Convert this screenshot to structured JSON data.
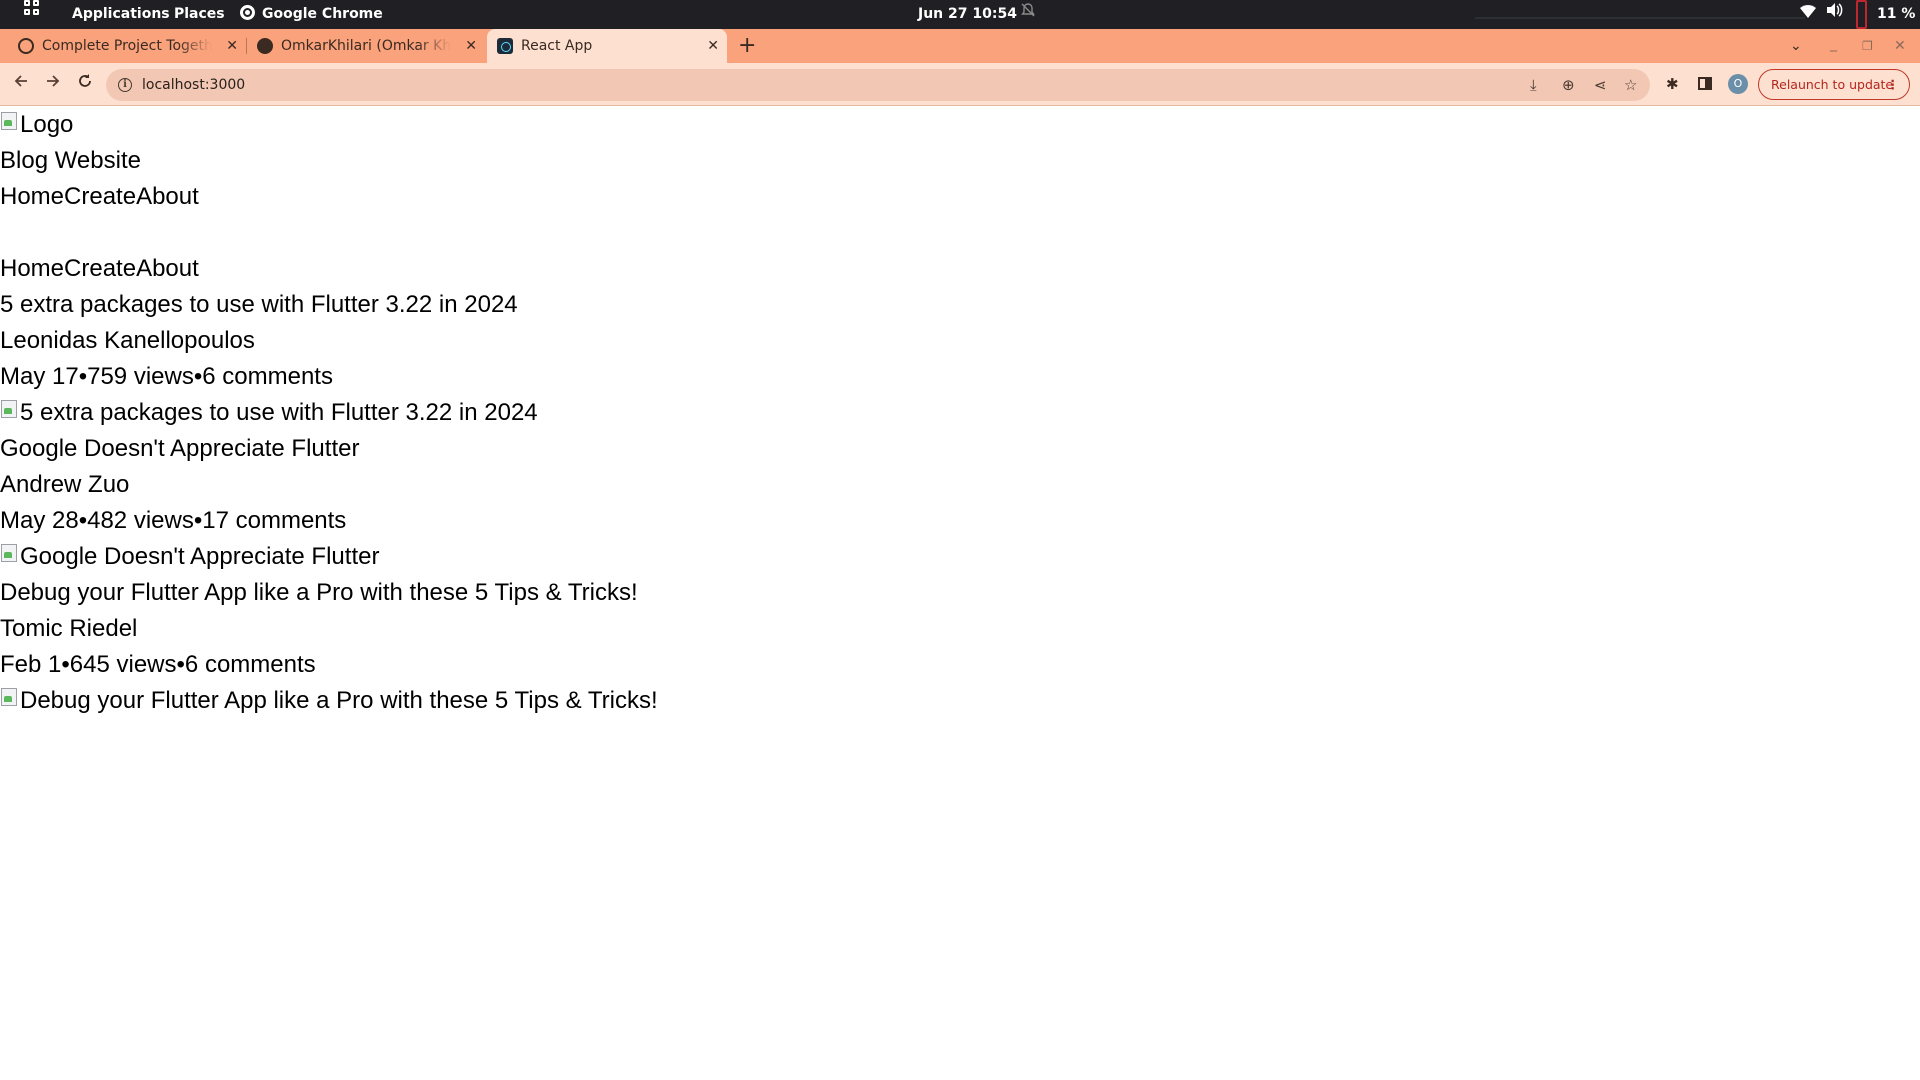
{
  "system_bar": {
    "applications_label": "Applications",
    "places_label": "Places",
    "active_app_label": "Google Chrome",
    "clock": "Jun 27  10:54",
    "battery": "11 %"
  },
  "browser": {
    "tabs": [
      {
        "title": "Complete Project Together"
      },
      {
        "title": "OmkarKhilari (Omkar Khilari)"
      },
      {
        "title": "React App"
      }
    ],
    "new_tab_symbol": "+",
    "address": "localhost:3000",
    "relaunch_label": "Relaunch to update",
    "profile_initial": "O"
  },
  "page": {
    "logo_alt": "Logo",
    "site_title": "Blog Website",
    "nav_top": [
      "Home",
      "Create",
      "About"
    ],
    "nav_bottom": [
      "Home",
      "Create",
      "About"
    ],
    "posts": [
      {
        "title": "5 extra packages to use with Flutter 3.22 in 2024",
        "author": "Leonidas Kanellopoulos",
        "date": "May 17",
        "views": "759 views",
        "comments": "6 comments",
        "image_alt": "5 extra packages to use with Flutter 3.22 in 2024"
      },
      {
        "title": "Google Doesn't Appreciate Flutter",
        "author": "Andrew Zuo",
        "date": "May 28",
        "views": "482 views",
        "comments": "17 comments",
        "image_alt": "Google Doesn't Appreciate Flutter"
      },
      {
        "title": "Debug your Flutter App like a Pro with these 5 Tips & Tricks!",
        "author": "Tomic Riedel",
        "date": "Feb 1",
        "views": "645 views",
        "comments": "6 comments",
        "image_alt": "Debug your Flutter App like a Pro with these 5 Tips & Tricks!"
      }
    ],
    "meta_separator": "•"
  },
  "icons": {
    "back": "back-arrow-icon",
    "forward": "forward-arrow-icon",
    "reload": "reload-icon",
    "info": "info-icon",
    "bookmark": "star-icon",
    "extensions": "puzzle-icon"
  }
}
